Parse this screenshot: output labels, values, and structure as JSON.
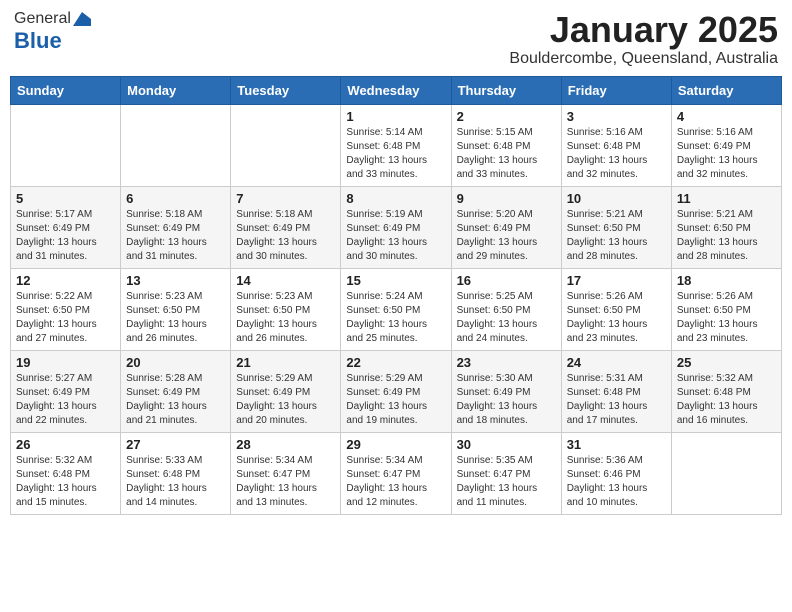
{
  "header": {
    "logo_general": "General",
    "logo_blue": "Blue",
    "month_year": "January 2025",
    "location": "Bouldercombe, Queensland, Australia"
  },
  "days_of_week": [
    "Sunday",
    "Monday",
    "Tuesday",
    "Wednesday",
    "Thursday",
    "Friday",
    "Saturday"
  ],
  "weeks": [
    [
      {
        "day": "",
        "info": ""
      },
      {
        "day": "",
        "info": ""
      },
      {
        "day": "",
        "info": ""
      },
      {
        "day": "1",
        "info": "Sunrise: 5:14 AM\nSunset: 6:48 PM\nDaylight: 13 hours\nand 33 minutes."
      },
      {
        "day": "2",
        "info": "Sunrise: 5:15 AM\nSunset: 6:48 PM\nDaylight: 13 hours\nand 33 minutes."
      },
      {
        "day": "3",
        "info": "Sunrise: 5:16 AM\nSunset: 6:48 PM\nDaylight: 13 hours\nand 32 minutes."
      },
      {
        "day": "4",
        "info": "Sunrise: 5:16 AM\nSunset: 6:49 PM\nDaylight: 13 hours\nand 32 minutes."
      }
    ],
    [
      {
        "day": "5",
        "info": "Sunrise: 5:17 AM\nSunset: 6:49 PM\nDaylight: 13 hours\nand 31 minutes."
      },
      {
        "day": "6",
        "info": "Sunrise: 5:18 AM\nSunset: 6:49 PM\nDaylight: 13 hours\nand 31 minutes."
      },
      {
        "day": "7",
        "info": "Sunrise: 5:18 AM\nSunset: 6:49 PM\nDaylight: 13 hours\nand 30 minutes."
      },
      {
        "day": "8",
        "info": "Sunrise: 5:19 AM\nSunset: 6:49 PM\nDaylight: 13 hours\nand 30 minutes."
      },
      {
        "day": "9",
        "info": "Sunrise: 5:20 AM\nSunset: 6:49 PM\nDaylight: 13 hours\nand 29 minutes."
      },
      {
        "day": "10",
        "info": "Sunrise: 5:21 AM\nSunset: 6:50 PM\nDaylight: 13 hours\nand 28 minutes."
      },
      {
        "day": "11",
        "info": "Sunrise: 5:21 AM\nSunset: 6:50 PM\nDaylight: 13 hours\nand 28 minutes."
      }
    ],
    [
      {
        "day": "12",
        "info": "Sunrise: 5:22 AM\nSunset: 6:50 PM\nDaylight: 13 hours\nand 27 minutes."
      },
      {
        "day": "13",
        "info": "Sunrise: 5:23 AM\nSunset: 6:50 PM\nDaylight: 13 hours\nand 26 minutes."
      },
      {
        "day": "14",
        "info": "Sunrise: 5:23 AM\nSunset: 6:50 PM\nDaylight: 13 hours\nand 26 minutes."
      },
      {
        "day": "15",
        "info": "Sunrise: 5:24 AM\nSunset: 6:50 PM\nDaylight: 13 hours\nand 25 minutes."
      },
      {
        "day": "16",
        "info": "Sunrise: 5:25 AM\nSunset: 6:50 PM\nDaylight: 13 hours\nand 24 minutes."
      },
      {
        "day": "17",
        "info": "Sunrise: 5:26 AM\nSunset: 6:50 PM\nDaylight: 13 hours\nand 23 minutes."
      },
      {
        "day": "18",
        "info": "Sunrise: 5:26 AM\nSunset: 6:50 PM\nDaylight: 13 hours\nand 23 minutes."
      }
    ],
    [
      {
        "day": "19",
        "info": "Sunrise: 5:27 AM\nSunset: 6:49 PM\nDaylight: 13 hours\nand 22 minutes."
      },
      {
        "day": "20",
        "info": "Sunrise: 5:28 AM\nSunset: 6:49 PM\nDaylight: 13 hours\nand 21 minutes."
      },
      {
        "day": "21",
        "info": "Sunrise: 5:29 AM\nSunset: 6:49 PM\nDaylight: 13 hours\nand 20 minutes."
      },
      {
        "day": "22",
        "info": "Sunrise: 5:29 AM\nSunset: 6:49 PM\nDaylight: 13 hours\nand 19 minutes."
      },
      {
        "day": "23",
        "info": "Sunrise: 5:30 AM\nSunset: 6:49 PM\nDaylight: 13 hours\nand 18 minutes."
      },
      {
        "day": "24",
        "info": "Sunrise: 5:31 AM\nSunset: 6:48 PM\nDaylight: 13 hours\nand 17 minutes."
      },
      {
        "day": "25",
        "info": "Sunrise: 5:32 AM\nSunset: 6:48 PM\nDaylight: 13 hours\nand 16 minutes."
      }
    ],
    [
      {
        "day": "26",
        "info": "Sunrise: 5:32 AM\nSunset: 6:48 PM\nDaylight: 13 hours\nand 15 minutes."
      },
      {
        "day": "27",
        "info": "Sunrise: 5:33 AM\nSunset: 6:48 PM\nDaylight: 13 hours\nand 14 minutes."
      },
      {
        "day": "28",
        "info": "Sunrise: 5:34 AM\nSunset: 6:47 PM\nDaylight: 13 hours\nand 13 minutes."
      },
      {
        "day": "29",
        "info": "Sunrise: 5:34 AM\nSunset: 6:47 PM\nDaylight: 13 hours\nand 12 minutes."
      },
      {
        "day": "30",
        "info": "Sunrise: 5:35 AM\nSunset: 6:47 PM\nDaylight: 13 hours\nand 11 minutes."
      },
      {
        "day": "31",
        "info": "Sunrise: 5:36 AM\nSunset: 6:46 PM\nDaylight: 13 hours\nand 10 minutes."
      },
      {
        "day": "",
        "info": ""
      }
    ]
  ]
}
